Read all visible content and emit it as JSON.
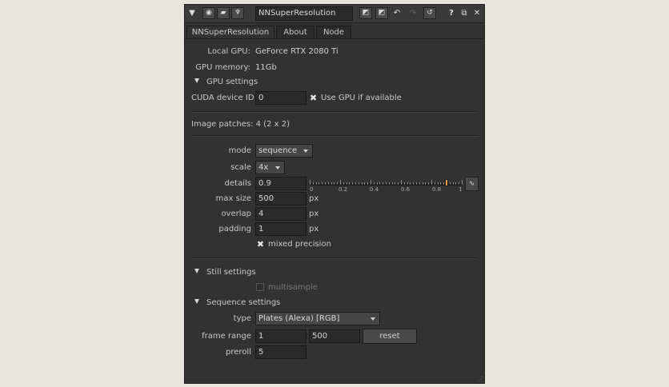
{
  "titlebar": {
    "node_name": "NNSuperResolution",
    "help_label": "?"
  },
  "tabs": [
    {
      "label": "NNSuperResolution"
    },
    {
      "label": "About"
    },
    {
      "label": "Node"
    }
  ],
  "gpu": {
    "local_gpu_label": "Local GPU:",
    "local_gpu_value": "GeForce RTX 2080 Ti",
    "gpu_memory_label": "GPU memory:",
    "gpu_memory_value": "11Gb",
    "section_label": "GPU settings",
    "cuda_label": "CUDA device ID",
    "cuda_value": "0",
    "use_gpu_label": "Use GPU if available",
    "use_gpu_checked": true
  },
  "patches": {
    "text": "Image patches: 4 (2 x 2)"
  },
  "params": {
    "mode_label": "mode",
    "mode_value": "sequence",
    "scale_label": "scale",
    "scale_value": "4x",
    "details_label": "details",
    "details_value": "0.9",
    "slider_ticks": [
      "0",
      "0.2",
      "0.4",
      "0.6",
      "0.8",
      "1"
    ],
    "slider_value": 0.9,
    "max_size_label": "max size",
    "max_size_value": "500",
    "overlap_label": "overlap",
    "overlap_value": "4",
    "padding_label": "padding",
    "padding_value": "1",
    "unit_px": "px",
    "mixed_precision_label": "mixed precision",
    "mixed_precision_checked": true
  },
  "still": {
    "section_label": "Still settings",
    "multisample_label": "multisample",
    "multisample_checked": false
  },
  "sequence": {
    "section_label": "Sequence settings",
    "type_label": "type",
    "type_value": "Plates (Alexa) [RGB]",
    "frame_range_label": "frame range",
    "frame_start": "1",
    "frame_end": "500",
    "reset_label": "reset",
    "preroll_label": "preroll",
    "preroll_value": "5"
  },
  "colors": {
    "panel_bg": "#323232",
    "field_bg": "#2a2a2a",
    "slider_handle": "#e0a040",
    "page_bg": "#e8e6dc"
  }
}
